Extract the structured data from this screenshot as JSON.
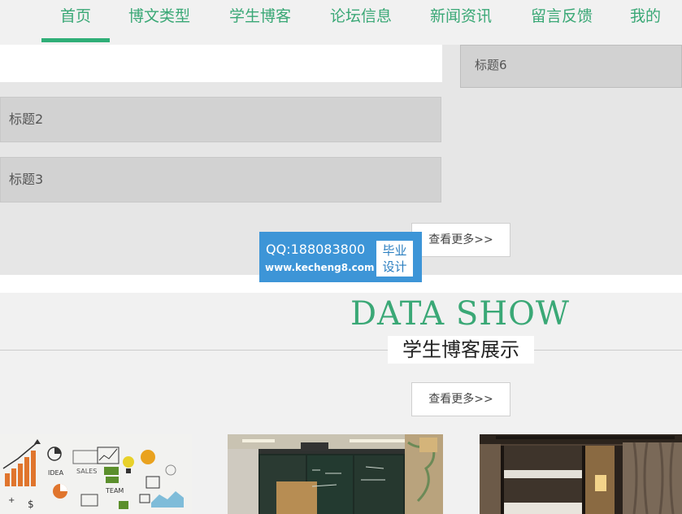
{
  "nav": {
    "items": [
      {
        "label": "首页"
      },
      {
        "label": "博文类型"
      },
      {
        "label": "学生博客"
      },
      {
        "label": "论坛信息"
      },
      {
        "label": "新闻资讯"
      },
      {
        "label": "留言反馈"
      },
      {
        "label": "我的"
      }
    ],
    "active_index": 0
  },
  "news": {
    "items": [
      {
        "title": "标题2"
      },
      {
        "title": "标题3"
      }
    ],
    "side_item": {
      "title": "标题6"
    },
    "more_label": "查看更多>>"
  },
  "watermark": {
    "qq": "QQ:188083800",
    "url": "www.kecheng8.com",
    "badge_line1": "毕业",
    "badge_line2": "设计"
  },
  "data_show": {
    "title": "DATA SHOW",
    "subtitle": "学生博客展示",
    "more_label": "查看更多>>"
  },
  "gallery": {
    "images": [
      {
        "icon": "business-chart-doodle-image"
      },
      {
        "icon": "classroom-chalkboard-image"
      },
      {
        "icon": "dormitory-bunk-bed-image"
      }
    ]
  },
  "colors": {
    "accent": "#3aa876",
    "active_bar": "#2fae77",
    "watermark_bg": "#3d95d7"
  }
}
